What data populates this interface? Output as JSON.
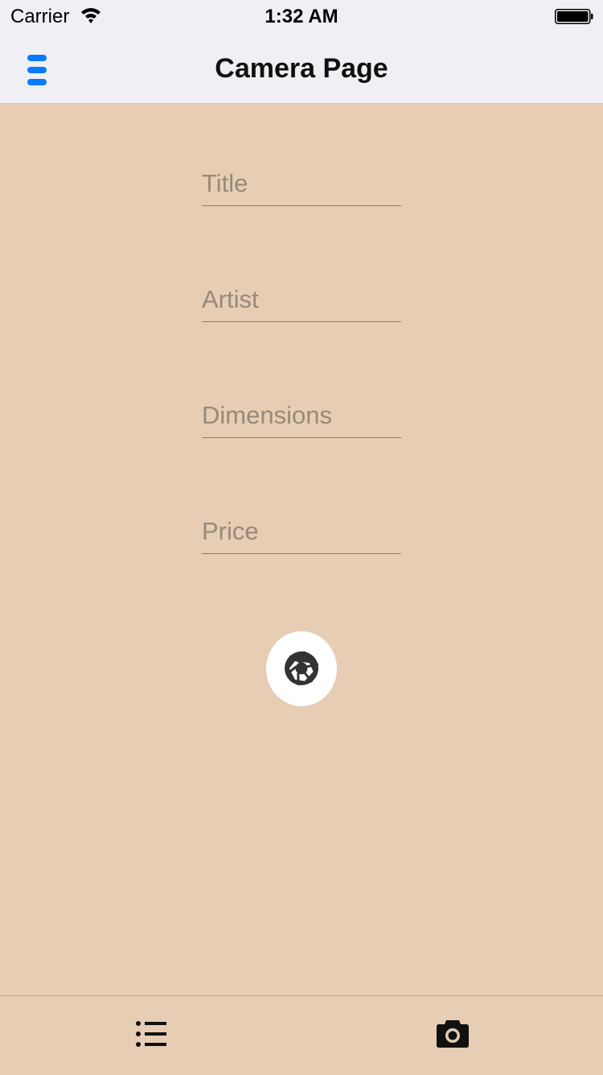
{
  "status_bar": {
    "carrier": "Carrier",
    "time": "1:32 AM",
    "icons": [
      "wifi-icon",
      "battery-icon"
    ]
  },
  "nav_bar": {
    "title": "Camera Page",
    "menu_icon": "menu-icon",
    "accent_color": "#0a7aff"
  },
  "form": {
    "fields": [
      {
        "placeholder": "Title",
        "value": ""
      },
      {
        "placeholder": "Artist",
        "value": ""
      },
      {
        "placeholder": "Dimensions",
        "value": ""
      },
      {
        "placeholder": "Price",
        "value": ""
      }
    ],
    "shutter_icon": "camera-shutter-icon"
  },
  "tab_bar": {
    "items": [
      {
        "icon": "list-icon"
      },
      {
        "icon": "camera-icon"
      }
    ]
  },
  "colors": {
    "background": "#e6cdb4",
    "bar_background": "#efeff4",
    "placeholder": "#978a7b",
    "icon_dark": "#333333"
  }
}
